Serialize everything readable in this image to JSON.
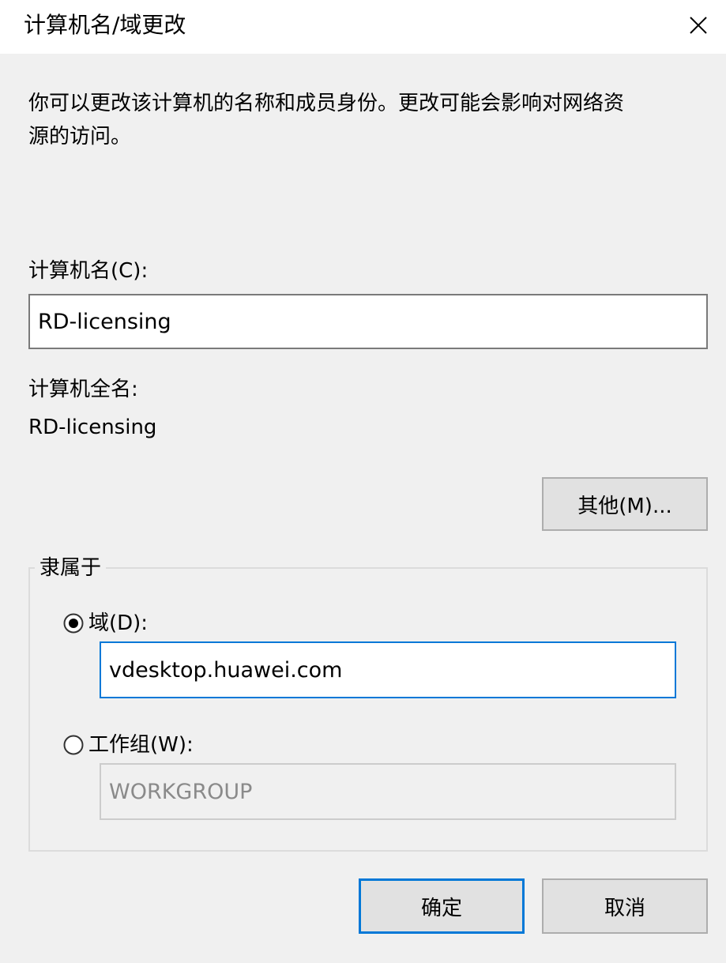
{
  "window": {
    "title": "计算机名/域更改"
  },
  "description": "你可以更改该计算机的名称和成员身份。更改可能会影响对网络资\n源的访问。",
  "computer_name": {
    "label": "计算机名(C):",
    "value": "RD-licensing"
  },
  "full_name": {
    "label": "计算机全名:",
    "value": "RD-licensing"
  },
  "other_button_label": "其他(M)...",
  "member_of": {
    "legend": "隶属于",
    "domain": {
      "label": "域(D):",
      "selected": true,
      "value": "vdesktop.huawei.com"
    },
    "workgroup": {
      "label": "工作组(W):",
      "selected": false,
      "value": "WORKGROUP"
    }
  },
  "buttons": {
    "ok_label": "确定",
    "cancel_label": "取消"
  },
  "icons": {
    "close": "close-icon",
    "radio_selected": "radio-selected-icon",
    "radio_unselected": "radio-unselected-icon"
  },
  "colors": {
    "focus_border": "#0078d7",
    "dialog_bg": "#f0f0f0",
    "disabled_text": "#8a8a8a"
  }
}
